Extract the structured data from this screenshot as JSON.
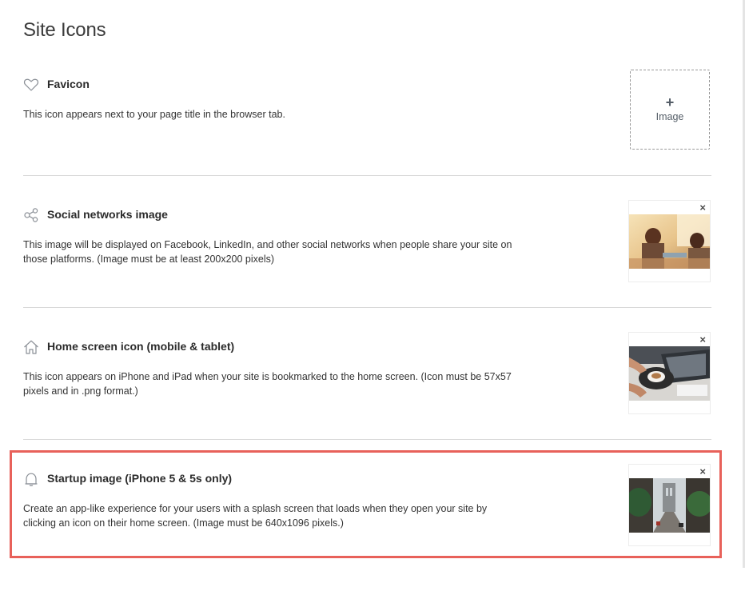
{
  "page": {
    "title": "Site Icons"
  },
  "sections": [
    {
      "id": "favicon",
      "icon": "heart-icon",
      "title": "Favicon",
      "description": "This icon appears next to your page title in the browser tab.",
      "upload_plus": "+",
      "upload_label": "Image"
    },
    {
      "id": "social",
      "icon": "share-icon",
      "title": "Social networks image",
      "description": "This image will be displayed on Facebook, LinkedIn, and other social networks when people share your site on those platforms. (Image must be at least 200x200 pixels)",
      "image": "people-at-table-photo",
      "remove": "×"
    },
    {
      "id": "homescreen",
      "icon": "home-icon",
      "title": "Home screen icon (mobile & tablet)",
      "description": "This icon appears on iPhone and iPad when your site is bookmarked to the home screen. (Icon must be 57x57 pixels and in .png format.)",
      "image": "laptop-coffee-photo",
      "remove": "×"
    },
    {
      "id": "startup",
      "icon": "bell-icon",
      "title": "Startup image (iPhone 5 & 5s only)",
      "description": "Create an app-like experience for your users with a splash screen that loads when they open your site by clicking an icon on their home screen. (Image must be 640x1096 pixels.)",
      "image": "city-bridge-street-photo",
      "remove": "×",
      "highlighted": true
    }
  ],
  "colors": {
    "highlight": "#e8615a",
    "divider": "#d9d9d9",
    "icon_stroke": "#8a8f96"
  }
}
